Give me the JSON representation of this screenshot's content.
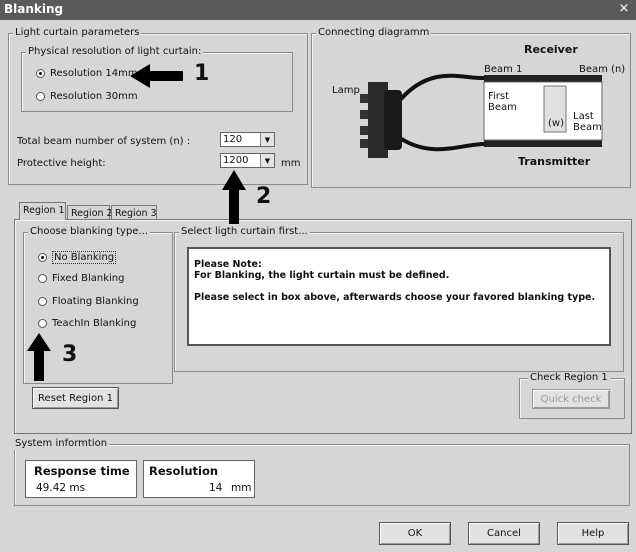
{
  "window": {
    "title": "Blanking",
    "close_glyph": "×"
  },
  "light_curtain": {
    "legend": "Light curtain parameters",
    "resolution_legend": "Physical resolution of light curtain:",
    "options": [
      "Resolution 14mm",
      "Resolution 30mm"
    ],
    "selected": 0,
    "total_beam_label": "Total beam number of system (n) :",
    "total_beam_value": "120",
    "protective_height_label": "Protective height:",
    "protective_height_value": "1200",
    "protective_height_unit": "mm"
  },
  "diagram": {
    "legend": "Connecting diagramm",
    "receiver": "Receiver",
    "transmitter": "Transmitter",
    "lamp": "Lamp",
    "beam1": "Beam 1",
    "beamn": "Beam (n)",
    "first_beam_1": "First",
    "first_beam_2": "Beam",
    "last_beam_1": "Last",
    "last_beam_2": "Beam",
    "w": "(w)"
  },
  "tabs": [
    "Region 1",
    "Region 2",
    "Region 3"
  ],
  "active_tab": 0,
  "blanking": {
    "legend": "Choose blanking type...",
    "options": [
      "No Blanking",
      "Fixed Blanking",
      "Floating Blanking",
      "TeachIn Blanking"
    ],
    "selected": 0
  },
  "select_curtain": {
    "legend": "Select ligth curtain first...",
    "note_line1": "Please Note:",
    "note_line2": "For Blanking, the light curtain must be defined.",
    "note_line3": "Please select in box above, afterwards choose your favored blanking type."
  },
  "reset_button": "Reset Region 1",
  "check_region": {
    "legend": "Check Region 1",
    "button": "Quick check"
  },
  "system_info": {
    "legend": "System informtion",
    "response_time_label": "Response time",
    "response_time_value": "49.42 ms",
    "resolution_label": "Resolution",
    "resolution_value": "14",
    "resolution_unit": "mm"
  },
  "buttons": {
    "ok": "OK",
    "cancel": "Cancel",
    "help": "Help"
  },
  "annotations": {
    "a1": "1",
    "a2": "2",
    "a3": "3"
  }
}
